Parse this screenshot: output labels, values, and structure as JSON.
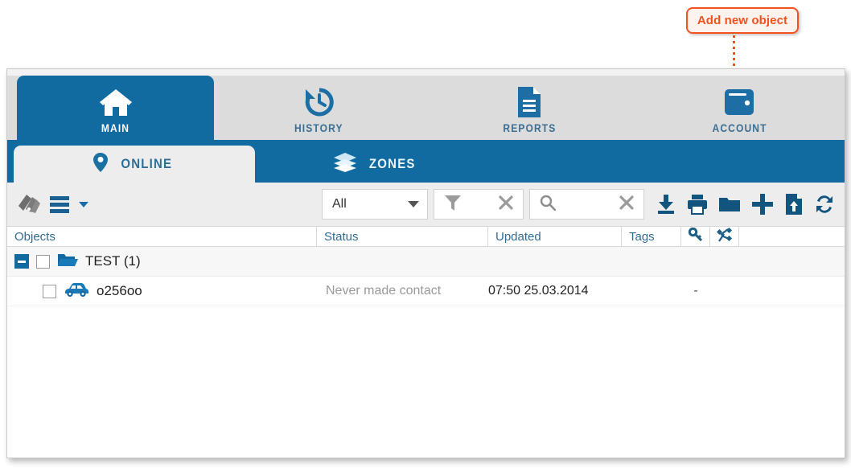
{
  "callout": {
    "text": "Add new object",
    "border_color": "#f4511e",
    "text_color": "#f4511e",
    "pointer": "dotted-line-to-add-button"
  },
  "top_tabs": [
    {
      "label": "MAIN",
      "icon": "home-icon",
      "active": true
    },
    {
      "label": "HISTORY",
      "icon": "history-icon",
      "active": false
    },
    {
      "label": "REPORTS",
      "icon": "document-icon",
      "active": false
    },
    {
      "label": "ACCOUNT",
      "icon": "wallet-icon",
      "active": false
    }
  ],
  "sub_tabs": [
    {
      "label": "ONLINE",
      "icon": "map-pin-icon",
      "active": true
    },
    {
      "label": "ZONES",
      "icon": "layers-icon",
      "active": false
    }
  ],
  "toolbar": {
    "left_icons": [
      {
        "name": "tags-palette-icon"
      },
      {
        "name": "list-menu-icon"
      },
      {
        "name": "chevron-down-icon"
      }
    ],
    "select_all": {
      "value": "All",
      "placeholder": "All"
    },
    "filter": {
      "icon": "funnel-icon",
      "clear_icon": "close-icon"
    },
    "search": {
      "icon": "search-icon",
      "value": "",
      "placeholder": "",
      "clear_icon": "close-icon"
    },
    "right_icons": [
      {
        "name": "download-icon"
      },
      {
        "name": "print-icon"
      },
      {
        "name": "folder-icon"
      },
      {
        "name": "add-icon"
      },
      {
        "name": "file-upload-icon"
      },
      {
        "name": "refresh-icon"
      }
    ]
  },
  "table": {
    "columns": [
      {
        "key": "objects",
        "label": "Objects"
      },
      {
        "key": "status",
        "label": "Status"
      },
      {
        "key": "updated",
        "label": "Updated"
      },
      {
        "key": "tags",
        "label": "Tags"
      },
      {
        "key": "key",
        "label": "",
        "icon": "key-icon"
      },
      {
        "key": "sat",
        "label": "",
        "icon": "satellite-icon"
      }
    ],
    "group": {
      "label": "TEST (1)",
      "icon": "folder-open-icon",
      "collapsed": false,
      "checked": false
    },
    "rows": [
      {
        "name": "o256oo",
        "icon": "car-icon",
        "checked": false,
        "status": "Never made contact",
        "updated": "07:50 25.03.2014",
        "tags": "",
        "key": "-",
        "sat": ""
      }
    ]
  },
  "colors": {
    "brand_blue": "#116ba0",
    "tab_gray": "#dcdcdc",
    "toolbar_gray": "#ededed",
    "header_text": "#2e6d96",
    "muted_text": "#9a9a9a",
    "accent_orange": "#f4511e"
  }
}
